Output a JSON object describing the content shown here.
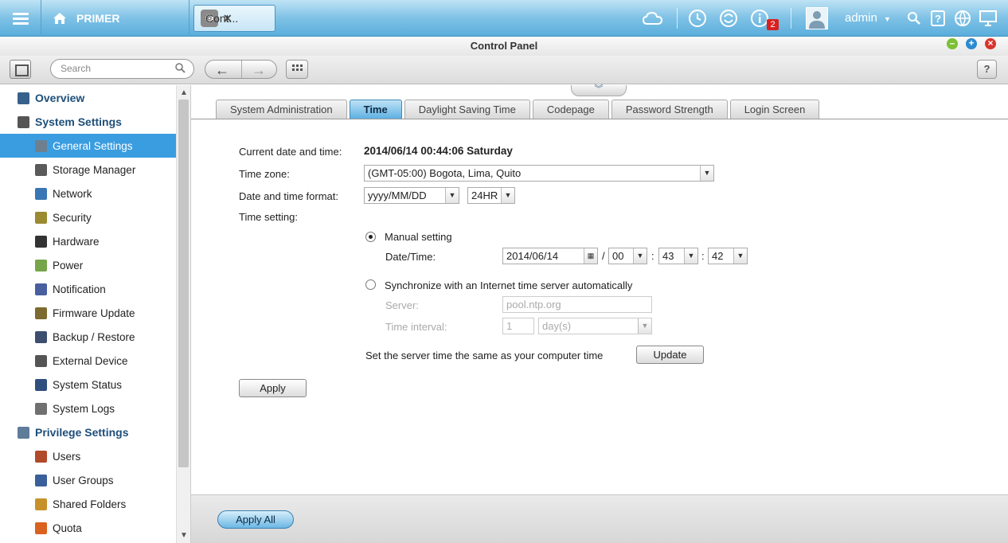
{
  "topbar": {
    "home_label": "PRIMER",
    "app_tab_label": "Cont...",
    "app_tab_close": "✕",
    "notification_count": "2",
    "username": "admin",
    "user_caret": "▼"
  },
  "window": {
    "title": "Control Panel"
  },
  "toolbar": {
    "search_placeholder": "Search",
    "help_label": "?"
  },
  "sidebar": {
    "items": [
      {
        "label": "Overview",
        "kind": "category",
        "icon": "overview-icon"
      },
      {
        "label": "System Settings",
        "kind": "category",
        "icon": "gear-icon"
      },
      {
        "label": "General Settings",
        "kind": "sub",
        "icon": "general-settings-icon",
        "active": true
      },
      {
        "label": "Storage Manager",
        "kind": "sub",
        "icon": "storage-icon"
      },
      {
        "label": "Network",
        "kind": "sub",
        "icon": "network-icon"
      },
      {
        "label": "Security",
        "kind": "sub",
        "icon": "lock-icon"
      },
      {
        "label": "Hardware",
        "kind": "sub",
        "icon": "hardware-icon"
      },
      {
        "label": "Power",
        "kind": "sub",
        "icon": "power-icon"
      },
      {
        "label": "Notification",
        "kind": "sub",
        "icon": "notification-icon"
      },
      {
        "label": "Firmware Update",
        "kind": "sub",
        "icon": "firmware-icon"
      },
      {
        "label": "Backup / Restore",
        "kind": "sub",
        "icon": "backup-icon"
      },
      {
        "label": "External Device",
        "kind": "sub",
        "icon": "external-device-icon"
      },
      {
        "label": "System Status",
        "kind": "sub",
        "icon": "monitor-icon"
      },
      {
        "label": "System Logs",
        "kind": "sub",
        "icon": "logs-icon"
      },
      {
        "label": "Privilege Settings",
        "kind": "category",
        "icon": "user-icon"
      },
      {
        "label": "Users",
        "kind": "sub",
        "icon": "users-icon"
      },
      {
        "label": "User Groups",
        "kind": "sub",
        "icon": "user-groups-icon"
      },
      {
        "label": "Shared Folders",
        "kind": "sub",
        "icon": "folder-icon"
      },
      {
        "label": "Quota",
        "kind": "sub",
        "icon": "quota-icon"
      }
    ]
  },
  "tabs": [
    {
      "label": "System Administration"
    },
    {
      "label": "Time",
      "active": true
    },
    {
      "label": "Daylight Saving Time"
    },
    {
      "label": "Codepage"
    },
    {
      "label": "Password Strength"
    },
    {
      "label": "Login Screen"
    }
  ],
  "form": {
    "current_label": "Current date and time:",
    "current_value": "2014/06/14 00:44:06 Saturday",
    "timezone_label": "Time zone:",
    "timezone_value": "(GMT-05:00) Bogota, Lima, Quito",
    "format_label": "Date and time format:",
    "date_format_value": "yyyy/MM/DD",
    "hour_format_value": "24HR",
    "time_setting_label": "Time setting:",
    "manual_label": "Manual setting",
    "manual_selected": true,
    "datetime_label": "Date/Time:",
    "date_value": "2014/06/14",
    "slash": "/",
    "hour_value": "00",
    "colon": ":",
    "minute_value": "43",
    "second_value": "42",
    "sync_label": "Synchronize with an Internet time server automatically",
    "server_label": "Server:",
    "server_value": "pool.ntp.org",
    "interval_label": "Time interval:",
    "interval_value": "1",
    "interval_unit": "day(s)",
    "same_time_label": "Set the server time the same as your computer time",
    "update_button": "Update",
    "apply_button": "Apply"
  },
  "footer": {
    "apply_all_button": "Apply All"
  },
  "colors": {
    "accent": "#3a9de0",
    "topbar": "#5aaedc",
    "category_text": "#1d4f7a",
    "badge": "#d8211f"
  }
}
